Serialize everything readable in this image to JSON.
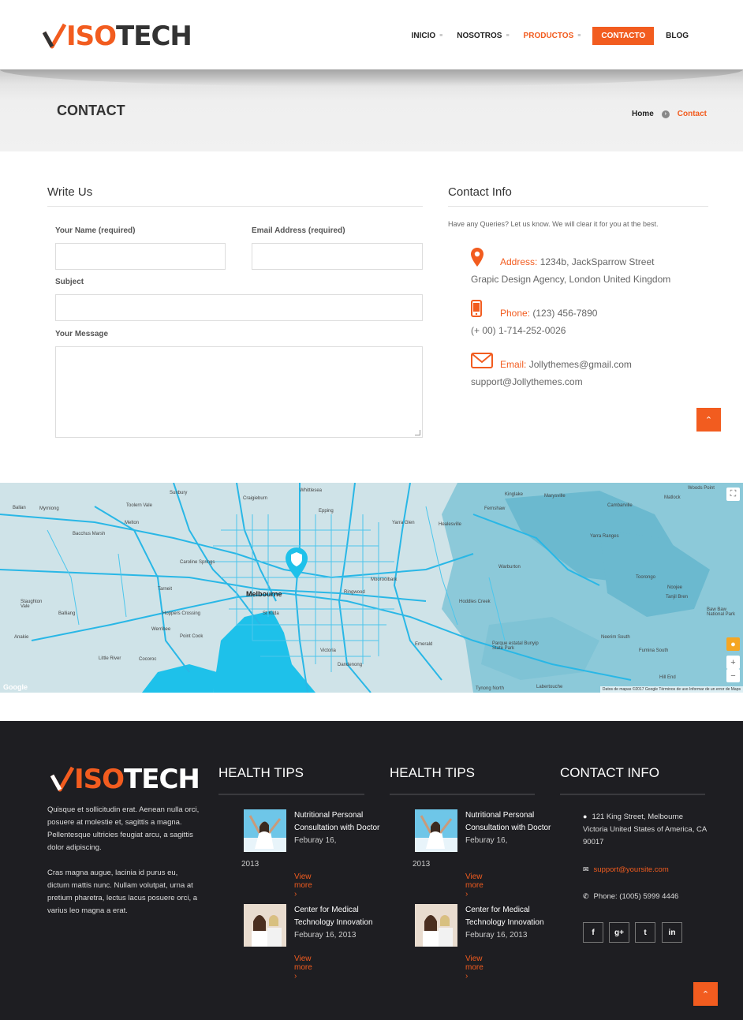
{
  "brand": {
    "logo_iso": "ISO",
    "logo_tech": "TECH",
    "accent": "#f25c1f"
  },
  "nav": {
    "items": [
      {
        "label": "INICIO"
      },
      {
        "label": "NOSOTROS"
      },
      {
        "label": "PRODUCTOS"
      },
      {
        "label": "CONTACTO"
      },
      {
        "label": "BLOG"
      }
    ]
  },
  "banner": {
    "title": "CONTACT",
    "breadcrumb_home": "Home",
    "breadcrumb_current": "Contact"
  },
  "write_us": {
    "title": "Write Us",
    "name_label": "Your Name (required)",
    "email_label": "Email Address (required)",
    "subject_label": "Subject",
    "message_label": "Your Message"
  },
  "contact_info": {
    "title": "Contact Info",
    "intro": "Have any Queries? Let us know. We will clear it for you at the best.",
    "address_key": "Address:",
    "address_line1": "1234b, JackSparrow Street",
    "address_line2": "Grapic Design Agency, London United Kingdom",
    "phone_key": "Phone:",
    "phone_line1": "(123) 456-7890",
    "phone_line2": "(+ 00) 1-714-252-0026",
    "email_key": "Email:",
    "email_line1": "Jollythemes@gmail.com",
    "email_line2": "support@Jollythemes.com"
  },
  "map": {
    "city": "Melbourne",
    "labels": [
      "Sunbury",
      "Craigieburn",
      "Epping",
      "Bacchus Marsh",
      "Caroline Springs",
      "Tarneit",
      "Werribee",
      "Hoppers Crossing",
      "Point Cook",
      "St Kilda",
      "Ringwood",
      "Warburton",
      "Yarra Ranges",
      "Hoddles Creek",
      "Emerald",
      "Dandenong",
      "Little River",
      "Parque estatal Bunyip State Park",
      "Neerim South",
      "Tynong North",
      "Labertouche",
      "Yarra Glen",
      "Healesville",
      "Whittlesea",
      "Kinglake",
      "Marysville",
      "Cambarville",
      "Matlock",
      "Woods Point",
      "Toorongo",
      "Tanjil Bren",
      "Noojee",
      "Fumina South",
      "Hill End",
      "Baw Baw National Park",
      "Staughton Vale",
      "Balliang",
      "Anakie",
      "Myrniong",
      "Ballan",
      "Toolern Vale",
      "Melton",
      "Mooroolbark",
      "Cocoroc",
      "Victoria",
      "Fernshaw"
    ],
    "attribution": "Datos de mapas ©2017 Google   Términos de uso   Informar de un error de Maps",
    "google": "Google"
  },
  "footer": {
    "para1": "Quisque et sollicitudin erat. Aenean nulla orci, posuere at molestie et, sagittis a magna. Pellentesque ultricies feugiat arcu, a sagittis dolor adipiscing.",
    "para2": "Cras magna augue, lacinia id purus eu, dictum mattis nunc. Nullam volutpat, urna at pretium pharetra, lectus lacus posuere orci, a varius leo magna a erat.",
    "health1_title": "HEALTH TIPS",
    "health2_title": "HEALTH TIPS",
    "contact_title": "CONTACT INFO",
    "post1_title": "Nutritional Personal Consultation with Doctor",
    "post1_date": "Feburay 16,",
    "post1_year": "2013",
    "post2_title": "Center for Medical Technology Innovation",
    "post2_date": "Feburay 16, 2013",
    "view_more": "View more ›",
    "address": "121 King Street, Melbourne Victoria United States of America, CA 90017",
    "email": "support@yoursite.com",
    "phone": "Phone: (1005) 5999 4446",
    "social": [
      "f",
      "g+",
      "t",
      "in"
    ]
  },
  "back_to_top": "⌃"
}
